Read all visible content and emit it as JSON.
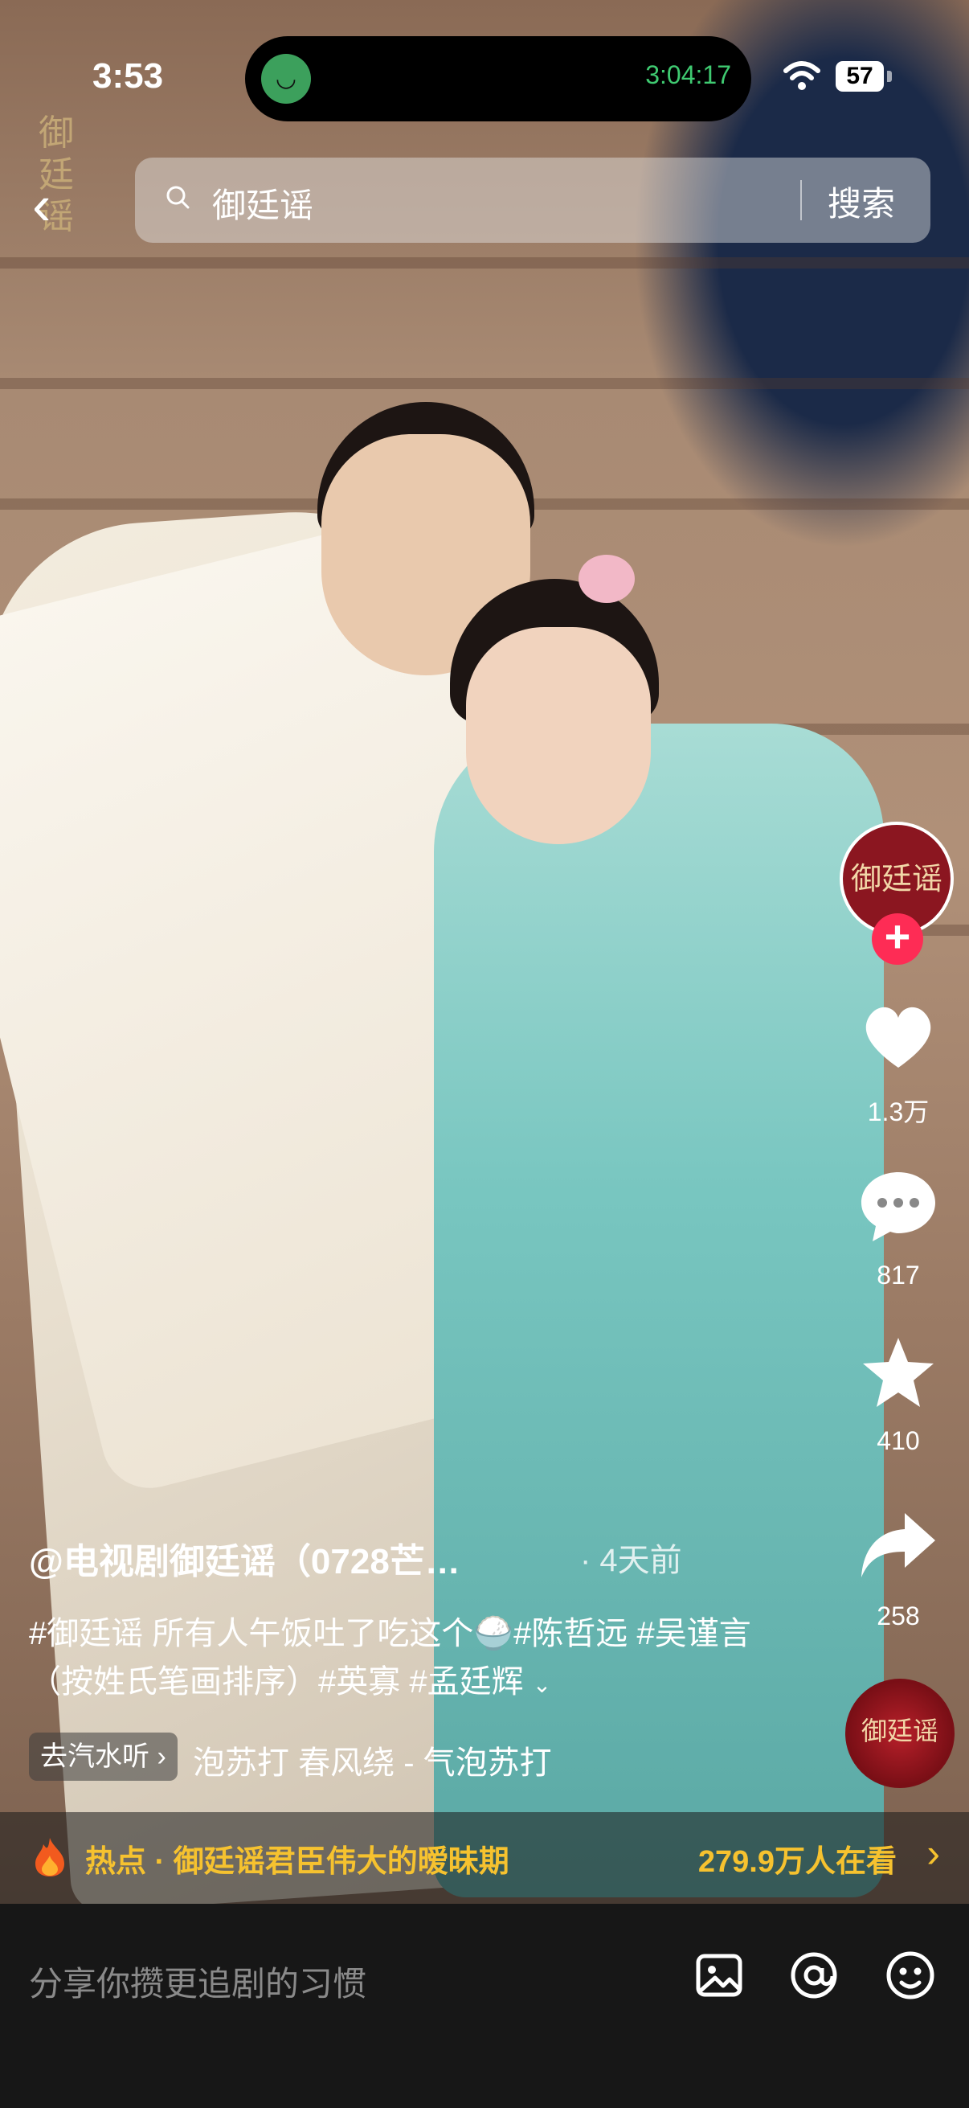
{
  "status_bar": {
    "time": "3:53",
    "timer": "3:04:17",
    "battery": "57"
  },
  "video": {
    "logo_text": "御廷谣"
  },
  "search": {
    "query": "御廷谣",
    "button_label": "搜索"
  },
  "side_actions": {
    "avatar_text": "御廷谣",
    "follow_label": "+",
    "likes": "1.3万",
    "comments": "817",
    "favorites": "410",
    "shares": "258",
    "music_disc_text": "御廷谣"
  },
  "post": {
    "author": "@电视剧御廷谣（0728芒…",
    "posted_ago": "· 4天前",
    "caption": "#御廷谣 所有人午饭吐了吃这个🍚#陈哲远 #吴谨言 （按姓氏笔画排序）#英寡 #孟廷辉",
    "expand_label": "⌄",
    "music_chip": "去汽水听 ›",
    "music_scroll": "泡苏打  春风绕 - 气泡苏打"
  },
  "hot": {
    "text": "热点 · 御廷谣君臣伟大的暧昧期",
    "viewers": "279.9万人在看",
    "arrow": "›"
  },
  "comment_input": {
    "placeholder": "分享你攒更追剧的习惯"
  },
  "colors": {
    "accent_red": "#fe2c55",
    "hot_yellow": "#f6c22f",
    "timer_green": "#3fca71"
  }
}
